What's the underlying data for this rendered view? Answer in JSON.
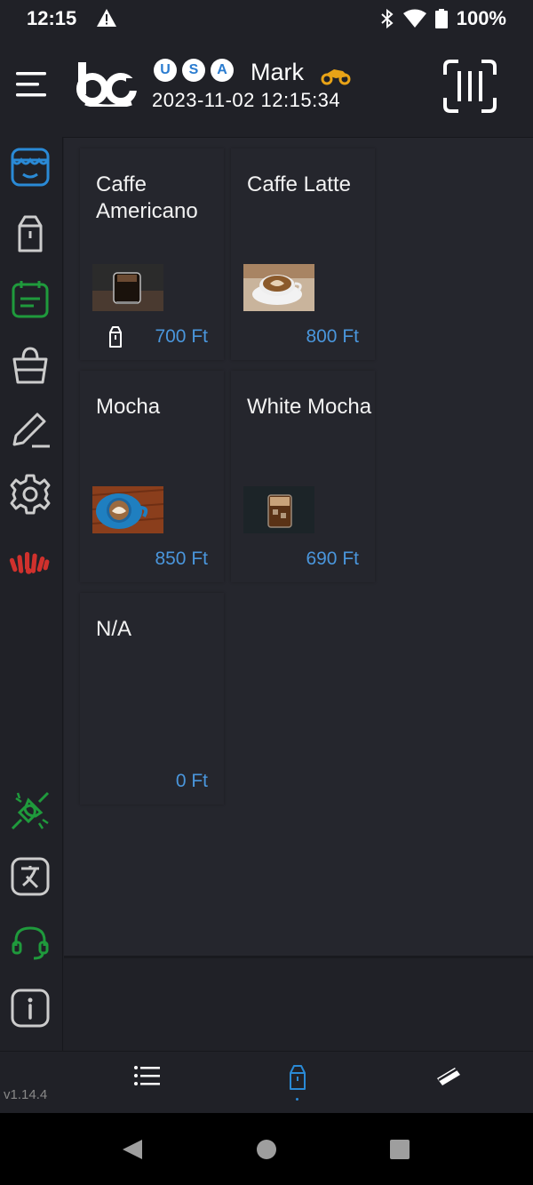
{
  "status_bar": {
    "time": "12:15",
    "battery": "100%"
  },
  "header": {
    "region_letters": [
      "U",
      "S",
      "A"
    ],
    "user_name": "Mark",
    "datetime": "2023-11-02 12:15:34"
  },
  "products": [
    {
      "name": "Caffe Americano",
      "price": "700 Ft",
      "image": "iced-coffee-photo",
      "takeaway": true
    },
    {
      "name": "Caffe Latte",
      "price": "800 Ft",
      "image": "latte-art-photo",
      "takeaway": false
    },
    {
      "name": "Mocha",
      "price": "850 Ft",
      "image": "blue-cup-latte-photo",
      "takeaway": false
    },
    {
      "name": "White Mocha",
      "price": "690 Ft",
      "image": "iced-mocha-photo",
      "takeaway": false
    },
    {
      "name": "N/A",
      "price": "0 Ft",
      "image": "",
      "takeaway": false
    }
  ],
  "footer": {
    "version": "v1.14.4"
  },
  "colors": {
    "background": "#202127",
    "panel": "#25262d",
    "accent_blue": "#2a8ad6",
    "price_blue": "#4a96dc",
    "green": "#1f9a3c",
    "red": "#d0312d"
  },
  "icons": {
    "sidebar": [
      "store-icon",
      "takeaway-bag-icon",
      "calendar-list-icon",
      "shopping-basket-icon",
      "edit-pencil-icon",
      "settings-gear-icon",
      "brand-logo-icon",
      "connection-plug-icon",
      "translate-icon",
      "support-headset-icon",
      "info-icon"
    ],
    "bottom_nav": [
      "list-icon",
      "takeaway-bag-icon",
      "card-icon"
    ]
  }
}
